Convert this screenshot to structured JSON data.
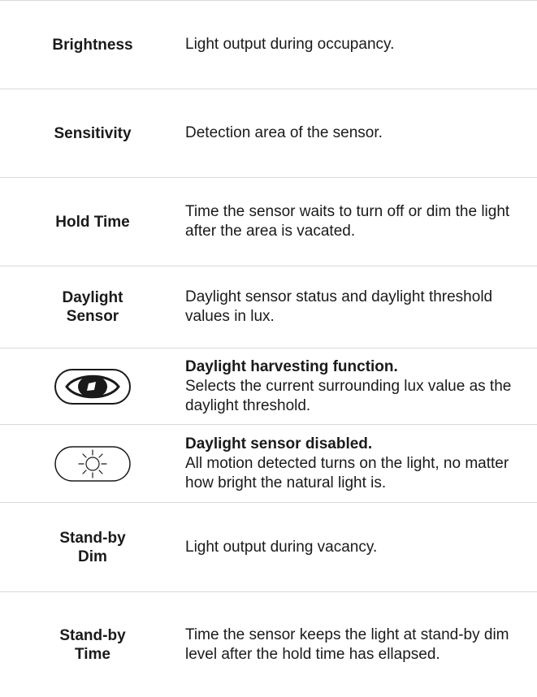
{
  "rows": [
    {
      "id": "brightness",
      "label": "Brightness",
      "description": "Light output during occupancy."
    },
    {
      "id": "sensitivity",
      "label": "Sensitivity",
      "description": "Detection area of the sensor."
    },
    {
      "id": "hold-time",
      "label": "Hold Time",
      "description": "Time the sensor waits to turn off or dim the light after the area is vacated."
    },
    {
      "id": "daylight-sensor",
      "label_line1": "Daylight",
      "label_line2": "Sensor",
      "description": "Daylight sensor status and daylight threshold values in lux."
    },
    {
      "id": "daylight-harvesting",
      "icon": "eye-button-icon",
      "title": "Daylight harvesting function.",
      "description": "Selects the current surrounding lux value as the daylight threshold."
    },
    {
      "id": "daylight-disabled",
      "icon": "sun-button-icon",
      "title": "Daylight sensor disabled.",
      "description": "All motion detected turns on the light, no matter how bright the natural light is."
    },
    {
      "id": "standby-dim",
      "label_line1": "Stand-by",
      "label_line2": "Dim",
      "description": "Light output during vacancy."
    },
    {
      "id": "standby-time",
      "label_line1": "Stand-by",
      "label_line2": "Time",
      "description": "Time the sensor keeps the light at stand-by dim level after the hold time has ellapsed."
    }
  ]
}
